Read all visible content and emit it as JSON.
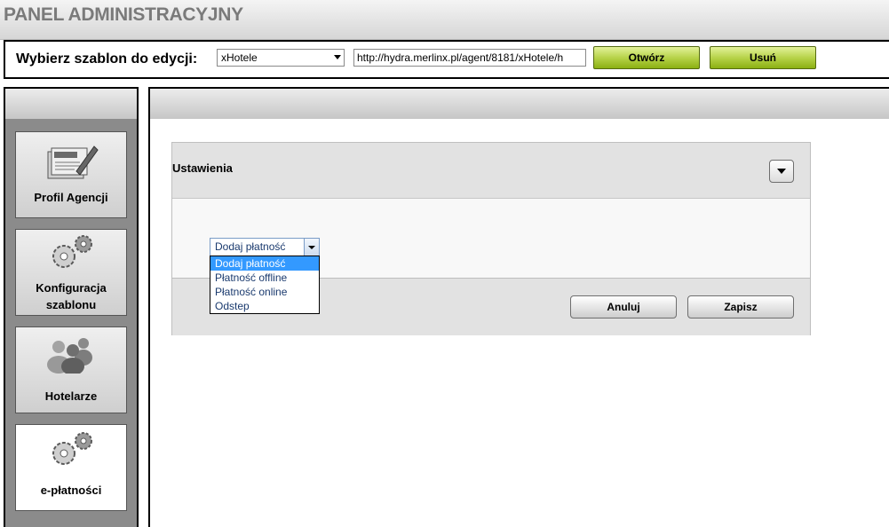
{
  "header": {
    "title": "PANEL ADMINISTRACYJNY"
  },
  "template_bar": {
    "label": "Wybierz szablon do edycji:",
    "selected_template": "xHotele",
    "url": "http://hydra.merlinx.pl/agent/8181/xHotele/h",
    "open_label": "Otwórz",
    "delete_label": "Usuń"
  },
  "sidebar": {
    "items": [
      {
        "label": "Profil Agencji",
        "icon": "profile-card-icon"
      },
      {
        "label": "Konfiguracja szablonu",
        "icon": "gears-icon"
      },
      {
        "label": "Hotelarze",
        "icon": "users-icon"
      },
      {
        "label": "e-płatności",
        "icon": "gears-icon",
        "active": true
      }
    ]
  },
  "settings_panel": {
    "title": "Ustawienia",
    "payment_select": {
      "value": "Dodaj płatność",
      "options": [
        "Dodaj płatność",
        "Płatność offline",
        "Płatność online",
        "Odstep"
      ],
      "highlighted": "Dodaj płatność"
    },
    "cancel_label": "Anuluj",
    "save_label": "Zapisz"
  },
  "colors": {
    "accent_green": "#a6c630",
    "selection_blue": "#3399ff",
    "sidebar_bg": "#8b8b8b"
  }
}
